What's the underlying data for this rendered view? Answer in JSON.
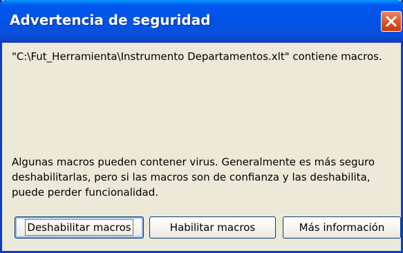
{
  "dialog": {
    "title": "Advertencia de seguridad",
    "file_message": "\"C:\\Fut_Herramienta\\Instrumento Departamentos.xlt\" contiene macros.",
    "warning_text": "Algunas macros pueden contener virus. Generalmente es más seguro deshabilitarlas, pero si las macros son de confianza y las deshabilita, puede perder funcionalidad.",
    "buttons": {
      "disable_label": "Deshabilitar macros",
      "enable_label": "Habilitar macros",
      "more_info_label": "Más información"
    },
    "icons": {
      "close": "close-icon"
    },
    "colors": {
      "titlebar": "#0053e6",
      "frame": "#0a3cc8",
      "close_button": "#d9532d",
      "body": "#ece9d8"
    }
  }
}
